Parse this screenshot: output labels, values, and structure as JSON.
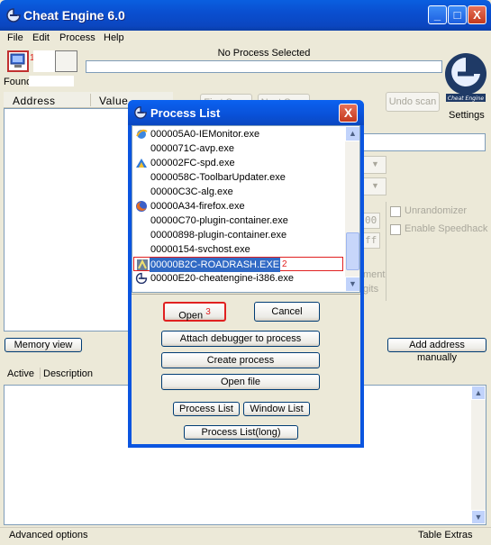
{
  "window": {
    "title": "Cheat Engine 6.0",
    "minimize": "_",
    "maximize": "□",
    "close": "X"
  },
  "menu": [
    "File",
    "Edit",
    "Process",
    "Help"
  ],
  "main": {
    "process_label": "No Process Selected",
    "found_label": "Found: 0",
    "address_col": "Address",
    "value_col": "Value",
    "settings_label": "Settings",
    "undo_scan": "Undo scan",
    "first_scan": "First Scan",
    "next_scan": "Next Scan",
    "unrandomizer": "Unrandomizer",
    "enable_speedhack": "Enable Speedhack",
    "hex_00": "00",
    "hex_ff": "ff",
    "ment": "ment",
    "gits": "gits",
    "memory_view": "Memory view",
    "add_address": "Add address manually",
    "active_col": "Active",
    "description_col": "Description",
    "advanced_options": "Advanced options",
    "table_extras": "Table Extras",
    "marker_1": "1"
  },
  "dialog": {
    "title": "Process List",
    "close": "X",
    "processes": [
      {
        "text": "000005A0-IEMonitor.exe",
        "icon": "ie-icon"
      },
      {
        "text": "0000071C-avp.exe",
        "icon": "none"
      },
      {
        "text": "000002FC-spd.exe",
        "icon": "spd-icon"
      },
      {
        "text": "0000058C-ToolbarUpdater.exe",
        "icon": "none"
      },
      {
        "text": "00000C3C-alg.exe",
        "icon": "none"
      },
      {
        "text": "00000A34-firefox.exe",
        "icon": "firefox-icon"
      },
      {
        "text": "00000C70-plugin-container.exe",
        "icon": "none"
      },
      {
        "text": "00000898-plugin-container.exe",
        "icon": "none"
      },
      {
        "text": "00000154-svchost.exe",
        "icon": "none"
      },
      {
        "text": "00000B2C-ROADRASH.EXE",
        "icon": "roadrash-icon",
        "selected": true
      },
      {
        "text": "00000E20-cheatengine-i386.exe",
        "icon": "cheatengine-icon"
      }
    ],
    "marker_2": "2",
    "marker_3": "3",
    "open": "Open",
    "cancel": "Cancel",
    "attach_debugger": "Attach debugger to process",
    "create_process": "Create process",
    "open_file": "Open file",
    "process_list": "Process List",
    "window_list": "Window List",
    "process_list_long": "Process List(long)"
  },
  "colors": {
    "title_blue": "#0a5fe0",
    "selection": "#316ac5",
    "annotation_red": "#e02020"
  }
}
